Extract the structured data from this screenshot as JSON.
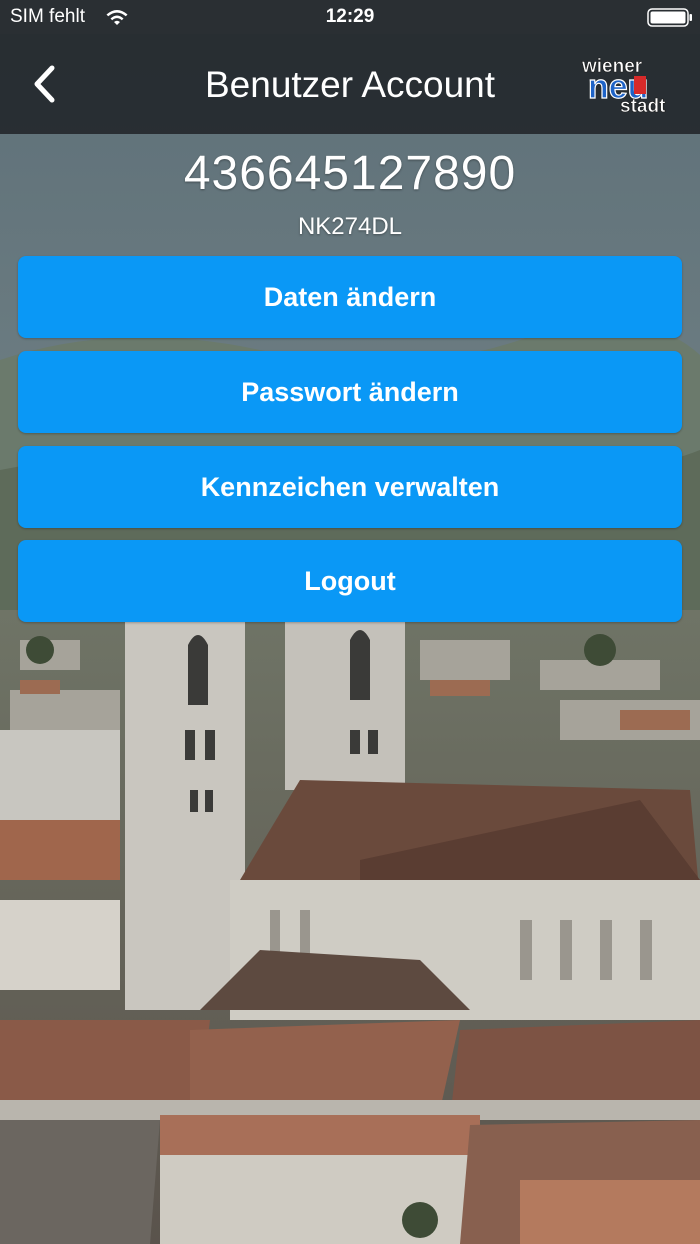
{
  "status_bar": {
    "carrier": "SIM fehlt",
    "time": "12:29",
    "wifi_icon": "wifi-icon",
    "battery_icon": "battery-icon"
  },
  "nav": {
    "title": "Benutzer Account",
    "back_icon": "chevron-left-icon",
    "logo_text": {
      "top": "wiener",
      "middle": "neu",
      "bottom": "stadt"
    }
  },
  "account": {
    "number": "436645127890",
    "plate": "NK274DL"
  },
  "buttons": {
    "edit_data": "Daten ändern",
    "change_password": "Passwort ändern",
    "manage_plates": "Kennzeichen verwalten",
    "logout": "Logout"
  },
  "colors": {
    "button": "#0a98f6",
    "nav_background": "#24282c",
    "text": "#ffffff"
  }
}
